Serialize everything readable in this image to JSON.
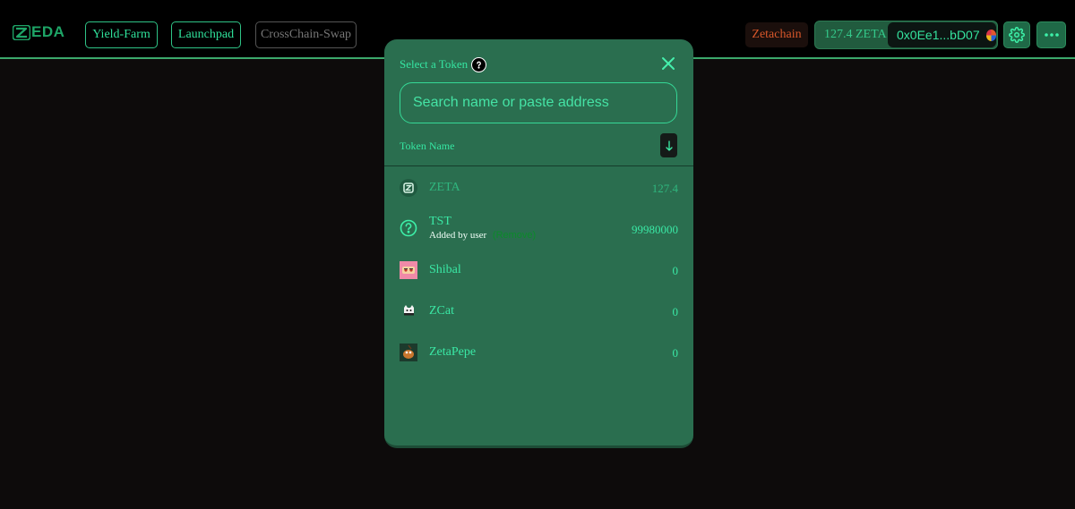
{
  "header": {
    "logo_text": "EDA",
    "nav": [
      {
        "label": "Yield-Farm",
        "enabled": true
      },
      {
        "label": "Launchpad",
        "enabled": true
      },
      {
        "label": "CrossChain-Swap",
        "enabled": false
      }
    ],
    "chain": "Zetachain",
    "wallet_balance": "127.4 ZETA",
    "wallet_address": "0x0Ee1...bD07",
    "settings_icon": "gear-icon",
    "more_icon": "more-horizontal-icon"
  },
  "modal": {
    "title": "Select a Token",
    "search": {
      "placeholder": "Search name or paste address",
      "value": ""
    },
    "list_header": "Token Name",
    "tokens": [
      {
        "symbol": "ZETA",
        "balance": "127.4",
        "icon": "zeta-logo",
        "selected": true
      },
      {
        "symbol": "TST",
        "balance": "99980000",
        "icon": "question-circle-icon",
        "note": "Added by user",
        "action": "(Remove)"
      },
      {
        "symbol": "Shibal",
        "balance": "0",
        "icon": "shibal-logo"
      },
      {
        "symbol": "ZCat",
        "balance": "0",
        "icon": "zcat-logo"
      },
      {
        "symbol": "ZetaPepe",
        "balance": "0",
        "icon": "zetapepe-logo"
      }
    ]
  },
  "colors": {
    "accent": "#35e6a2",
    "modal_bg": "#2a6e4f",
    "page_bg": "#0d0b0b",
    "chain_text": "#d8572a"
  }
}
